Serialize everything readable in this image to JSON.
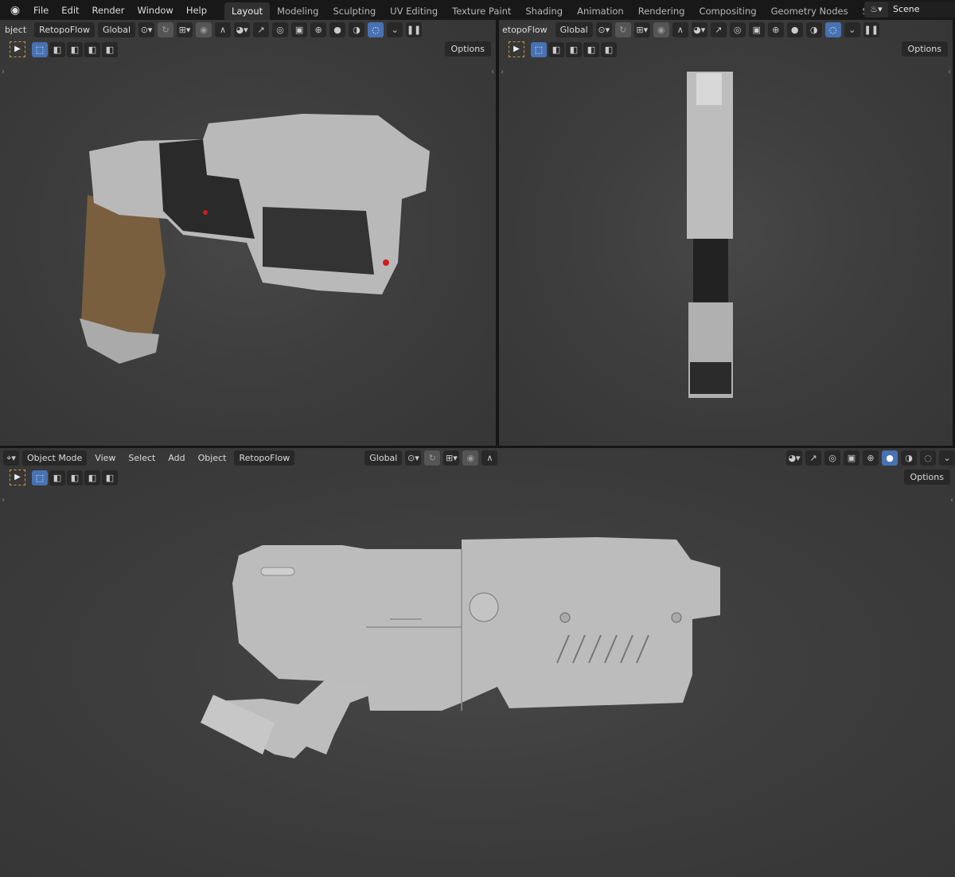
{
  "menu": [
    "File",
    "Edit",
    "Render",
    "Window",
    "Help"
  ],
  "workspaces": [
    "Layout",
    "Modeling",
    "Sculpting",
    "UV Editing",
    "Texture Paint",
    "Shading",
    "Animation",
    "Rendering",
    "Compositing",
    "Geometry Nodes",
    "Scripting"
  ],
  "active_workspace": "Layout",
  "add_workspace": "+",
  "scene": {
    "name": "Scene",
    "icon": "scene-icon"
  },
  "viewports": [
    {
      "mode_partial": "bject",
      "addon": "RetopoFlow",
      "orientation": "Global",
      "options": "Options",
      "shading_active": "rendered"
    },
    {
      "addon_partial": "etopoFlow",
      "orientation": "Global",
      "options": "Options",
      "shading_active": "rendered"
    },
    {
      "mode": "Object Mode",
      "menus": [
        "View",
        "Select",
        "Add",
        "Object"
      ],
      "addon": "RetopoFlow",
      "orientation": "Global",
      "options": "Options",
      "shading_active": "solid"
    }
  ],
  "colors": {
    "accent": "#4772b3",
    "viewport_bg": "#3d3d3d",
    "header_bg": "#181818",
    "select_tool": "#d89a3a"
  }
}
